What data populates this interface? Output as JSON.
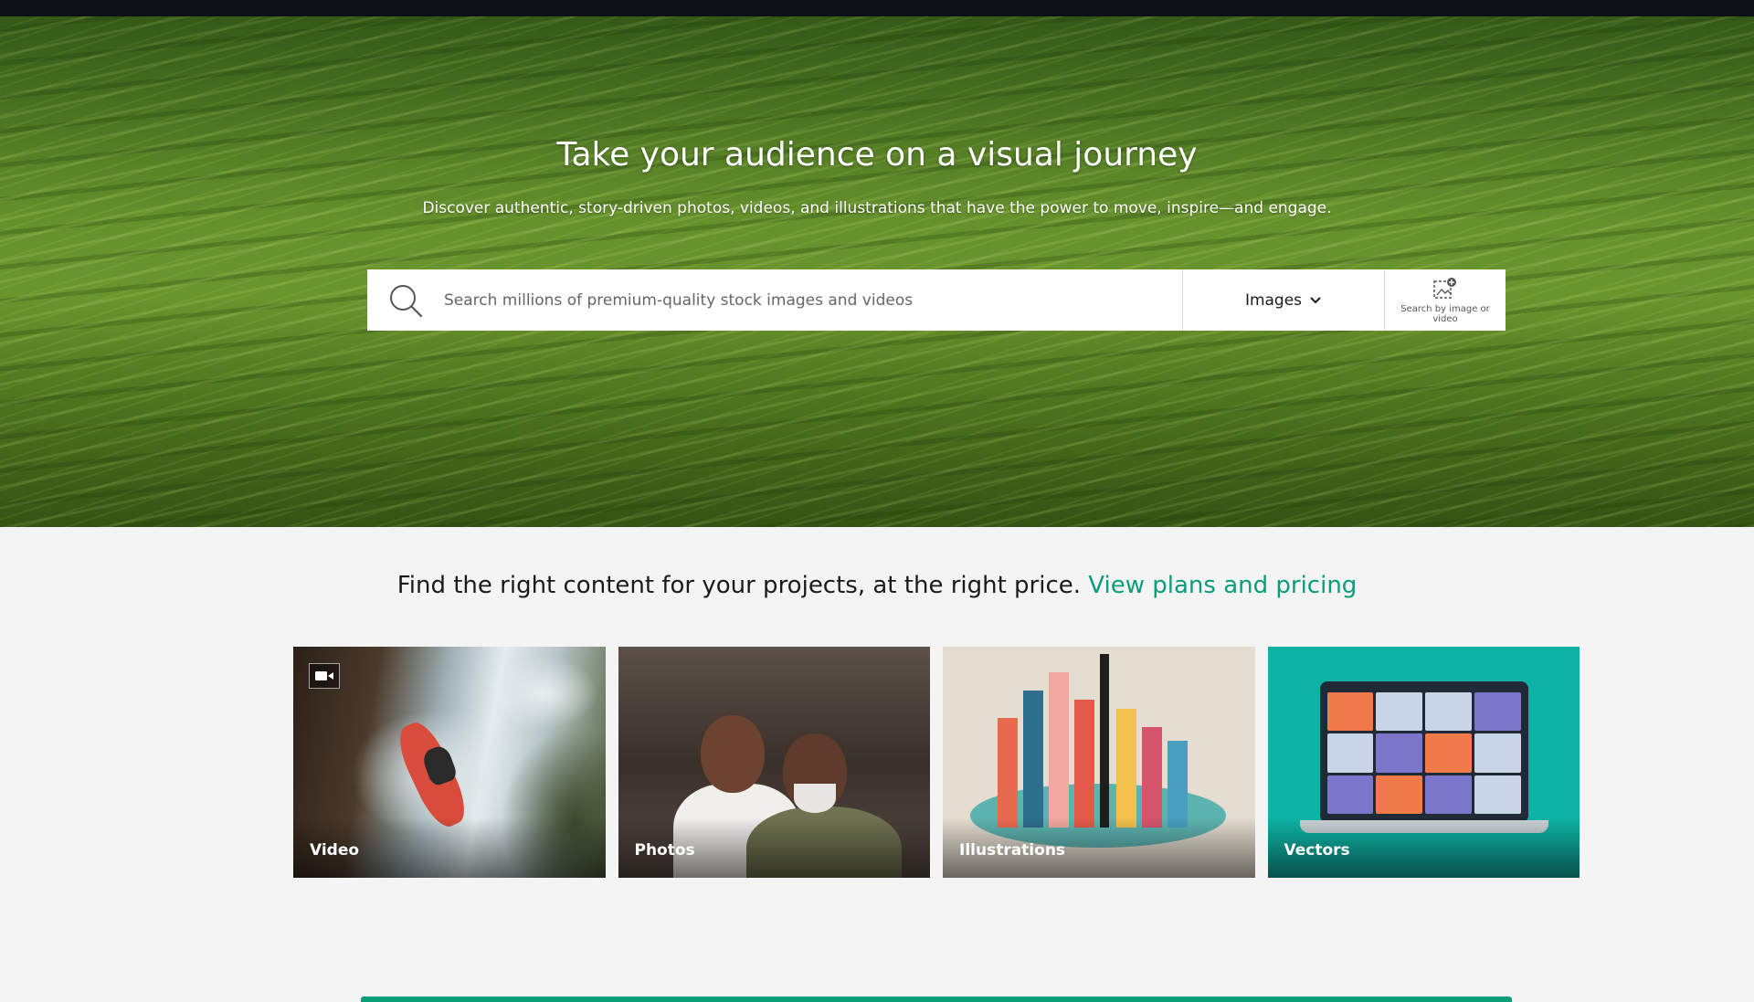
{
  "hero": {
    "title": "Take your audience on a visual journey",
    "subtitle": "Discover authentic, story-driven photos, videos, and illustrations that have the power to move, inspire—and engage."
  },
  "search": {
    "placeholder": "Search millions of premium-quality stock images and videos",
    "type_label": "Images",
    "image_search_label": "Search by image or video"
  },
  "pricing": {
    "text": "Find the right content for your projects, at the right price.",
    "link": "View plans and pricing",
    "link_color": "#0a9d7a"
  },
  "categories": [
    {
      "label": "Video",
      "icon": "video-camera-icon"
    },
    {
      "label": "Photos"
    },
    {
      "label": "Illustrations"
    },
    {
      "label": "Vectors"
    }
  ],
  "colors": {
    "accent": "#0a9d7a",
    "vectors_bg": "#0eb3a5",
    "topbar": "#0d1014"
  }
}
